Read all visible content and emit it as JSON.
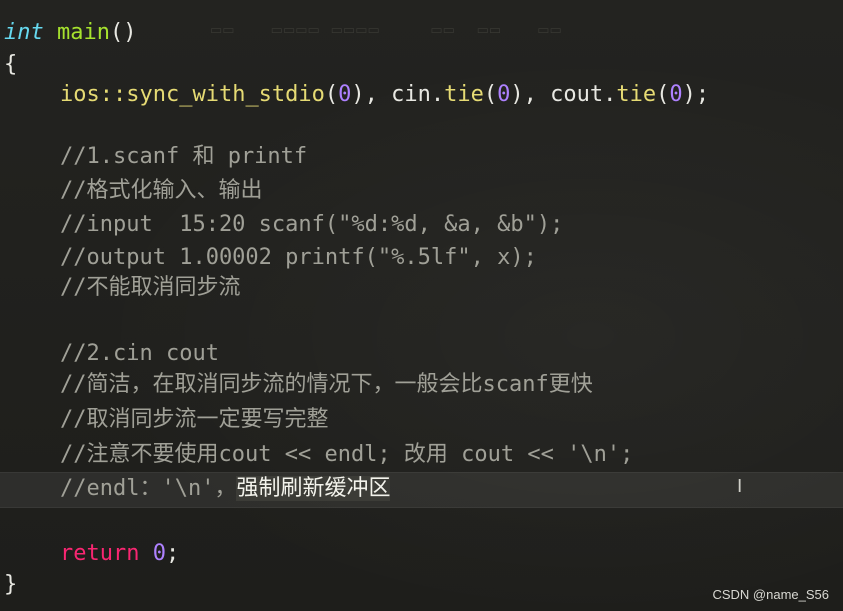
{
  "code": {
    "l1": {
      "type": "int",
      "name": "main",
      "parens": "()"
    },
    "l2": "{",
    "l3": {
      "ns": "ios::",
      "fn1": "sync_with_stdio",
      "a1": "(",
      "n1": "0",
      "b1": "), cin.",
      "fn2": "tie",
      "a2": "(",
      "n2": "0",
      "b2": "), cout.",
      "fn3": "tie",
      "a3": "(",
      "n3": "0",
      "b3": ");"
    },
    "c1": "//1.scanf 和 printf",
    "c2": "//格式化输入、输出",
    "c3": "//input  15:20 scanf(\"%d:%d, &a, &b\");",
    "c4": "//output 1.00002 printf(\"%.5lf\", x);",
    "c5": "//不能取消同步流",
    "c6": "//2.cin cout",
    "c7": "//简洁，在取消同步流的情况下，一般会比scanf更快",
    "c8": "//取消同步流一定要写完整",
    "c9": "//注意不要使用cout << endl; 改用 cout << '\\n';",
    "c10_prefix": "//endl：'\\n'，",
    "c10_selected": "强制刷新缓冲区",
    "ret_kw": "return",
    "ret_val": "0",
    "ret_end": ";",
    "close": "}"
  },
  "cursor_glyph": "I",
  "watermark": "CSDN @name_S56",
  "colors": {
    "background": "#1f1f1b",
    "keyword": "#f92672",
    "type": "#66d9ef",
    "function": "#e6db74",
    "number": "#ae81ff",
    "comment": "#a0a097"
  }
}
